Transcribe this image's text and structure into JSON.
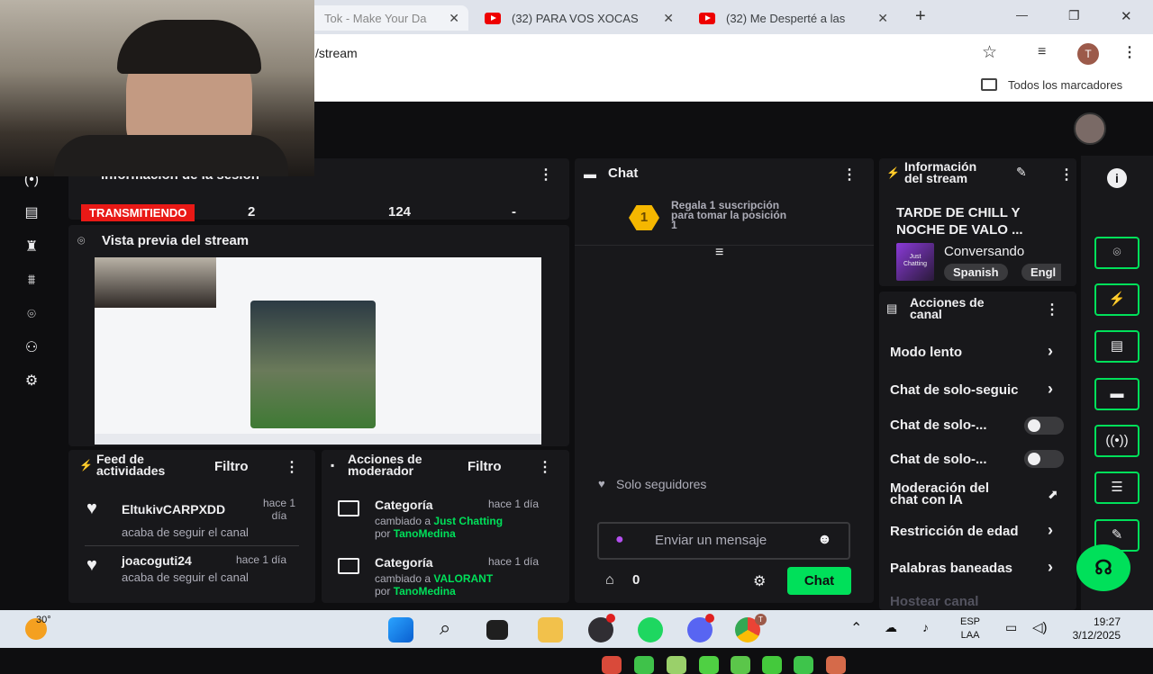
{
  "browser": {
    "tabs": [
      {
        "title": "Tok - Make Your Da",
        "close": "✕"
      },
      {
        "title": "(32) PARA VOS XOCAS",
        "close": "✕"
      },
      {
        "title": "(32) Me Desperté a las",
        "close": "✕"
      }
    ],
    "new_tab": "+",
    "win_min": "—",
    "win_max": "❐",
    "win_close": "✕",
    "url": "/stream",
    "profile_initial": "T",
    "bookmarks_label": "Todos los marcadores"
  },
  "session": {
    "title": "Información de la sesión",
    "status": "TRANSMITIENDO",
    "stat1": "2",
    "stat2": "124",
    "stat3": "-"
  },
  "preview": {
    "title": "Vista previa del stream"
  },
  "activity": {
    "title_line1": "Feed de",
    "title_line2": "actividades",
    "filter": "Filtro",
    "items": [
      {
        "user": "EltukivCARPXDD",
        "time1": "hace 1",
        "time2": "día",
        "text": "acaba de seguir el canal"
      },
      {
        "user": "joacoguti24",
        "time1": "hace 1 día",
        "text": "acaba de seguir el canal"
      }
    ]
  },
  "modactions": {
    "title_line1": "Acciones de",
    "title_line2": "moderador",
    "filter": "Filtro",
    "items": [
      {
        "label": "Categoría",
        "time": "hace 1 día",
        "changed": "cambiado a",
        "value": "Just Chatting",
        "by": "por",
        "user": "TanoMedina"
      },
      {
        "label": "Categoría",
        "time": "hace 1 día",
        "changed": "cambiado a",
        "value": "VALORANT",
        "by": "por",
        "user": "TanoMedina"
      }
    ]
  },
  "chat": {
    "title": "Chat",
    "gift_rank": "1",
    "gift_line1": "Regala 1 suscripción",
    "gift_line2": "para tomar la posición",
    "gift_line3": "1",
    "followers_only": "Solo seguidores",
    "placeholder": "Enviar un mensaje",
    "points": "0",
    "send": "Chat"
  },
  "streaminfo": {
    "title_line1": "Información",
    "title_line2": "del stream",
    "stream_title_line1": "TARDE DE CHILL Y",
    "stream_title_line2": "NOCHE DE VALO ...",
    "category": "Conversando",
    "tags": [
      "Spanish",
      "Engl"
    ],
    "box_art_line1": "Just",
    "box_art_line2": "Chatting"
  },
  "channel_actions": {
    "title_line1": "Acciones de",
    "title_line2": "canal",
    "items": [
      {
        "label": "Modo lento"
      },
      {
        "label": "Chat de solo-seguic"
      },
      {
        "label": "Chat de solo-..."
      },
      {
        "label": "Chat de solo-..."
      },
      {
        "label_line1": "Moderación del",
        "label_line2": "chat con IA"
      },
      {
        "label": "Restricción de edad"
      },
      {
        "label": "Palabras baneadas"
      },
      {
        "label": "Hostear canal"
      }
    ]
  },
  "taskbar": {
    "weather": "30°",
    "lang1": "ESP",
    "lang2": "LAA",
    "time": "19:27",
    "date": "3/12/2025",
    "chrome_badge": "T"
  },
  "colors": {
    "accent": "#00e05a",
    "live": "#e91916",
    "panel": "#18181b",
    "bg": "#0e0e10"
  }
}
